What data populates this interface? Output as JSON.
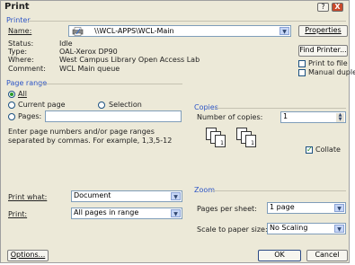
{
  "window": {
    "title": "Print"
  },
  "titlebar": {
    "help_glyph": "?",
    "close_glyph": "X"
  },
  "printer": {
    "group_label": "Printer",
    "name_label": "Name:",
    "name_value": "\\\\WCL-APPS\\WCL-Main",
    "properties_label": "Properties",
    "status_label": "Status:",
    "status_value": "Idle",
    "type_label": "Type:",
    "type_value": "OAL-Xerox DP90",
    "where_label": "Where:",
    "where_value": "West Campus Library Open Access Lab",
    "comment_label": "Comment:",
    "comment_value": "WCL Main queue",
    "find_printer_label": "Find Printer...",
    "print_to_file_label": "Print to file",
    "manual_duplex_label": "Manual duplex",
    "print_to_file_checked": false,
    "manual_duplex_checked": false
  },
  "page_range": {
    "group_label": "Page range",
    "all_label": "All",
    "current_page_label": "Current page",
    "selection_label": "Selection",
    "pages_label": "Pages:",
    "pages_value": "",
    "selected": "all",
    "hint": "Enter page numbers and/or page ranges separated by commas.  For example, 1,3,5-12"
  },
  "copies": {
    "group_label": "Copies",
    "number_label": "Number of copies:",
    "number_value": "1",
    "collate_label": "Collate",
    "collate_checked": true,
    "page_numbers": [
      "3",
      "2",
      "1",
      "3",
      "2",
      "1"
    ]
  },
  "print_what": {
    "label": "Print what:",
    "value": "Document"
  },
  "print": {
    "label": "Print:",
    "value": "All pages in range"
  },
  "zoom": {
    "group_label": "Zoom",
    "pages_per_sheet_label": "Pages per sheet:",
    "pages_per_sheet_value": "1 page",
    "scale_label": "Scale to paper size:",
    "scale_value": "No Scaling"
  },
  "buttons": {
    "options": "Options...",
    "ok": "OK",
    "cancel": "Cancel"
  },
  "icons": {
    "dropdown": "▼",
    "spin_up": "▲",
    "spin_down": "▼",
    "check": "✓"
  }
}
